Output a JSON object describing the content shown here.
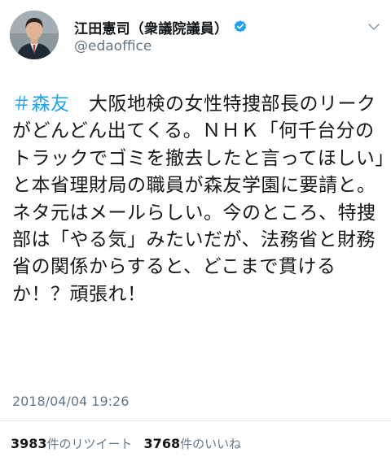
{
  "user": {
    "display_name": "江田憲司（衆議院議員）",
    "handle": "@edaoffice",
    "verified": true
  },
  "tweet": {
    "hashtag": "＃森友",
    "text": "　大阪地検の女性特捜部長のリークがどんどん出てくる。ＮＨＫ「何千台分のトラックでゴミを撤去したと言ってほしい」と本省理財局の職員が森友学園に要請と。ネタ元はメールらしい。今のところ、特捜部は「やる気」みたいだが、法務省と財務省の関係からすると、どこまで貫けるか！？頑張れ！",
    "timestamp": "2018/04/04 19:26"
  },
  "stats": {
    "retweets_count": "3983",
    "retweets_label": "件のリツイート",
    "likes_count": "3768",
    "likes_label": "件のいいね"
  },
  "colors": {
    "accent": "#1da1f2",
    "text_primary": "#14171a",
    "text_secondary": "#657786",
    "divider": "#e1e8ed"
  },
  "icons": {
    "verified": "verified-badge-icon",
    "menu": "chevron-down-icon"
  }
}
